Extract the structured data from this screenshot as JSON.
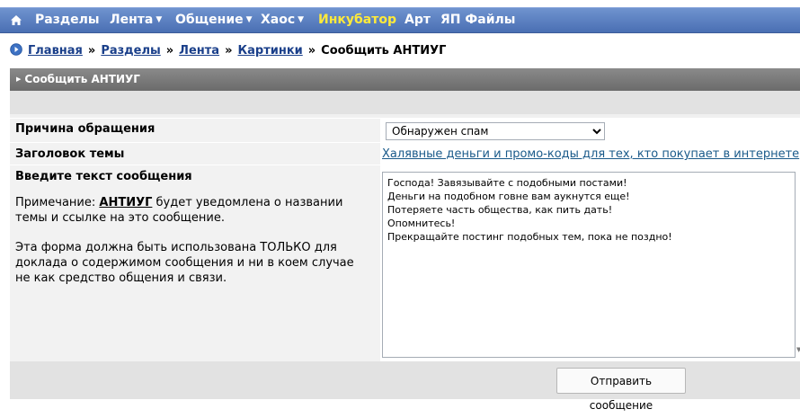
{
  "nav": {
    "items": [
      {
        "label": "Разделы",
        "dropdown": false
      },
      {
        "label": "Лента",
        "dropdown": true
      },
      {
        "label": "Общение",
        "dropdown": true
      },
      {
        "label": "Хаос",
        "dropdown": true
      },
      {
        "label": "Инкубатор",
        "dropdown": false,
        "color": "#ffea3a"
      },
      {
        "label": "Арт",
        "dropdown": false
      },
      {
        "label": "ЯП Файлы",
        "dropdown": false
      }
    ],
    "home_icon": "home-icon",
    "caret_icon": "triangle-down-icon",
    "bar_color": "#5b7fc1"
  },
  "breadcrumb": {
    "icon": "circle-arrow-icon",
    "items": [
      "Главная",
      "Разделы",
      "Лента",
      "Картинки"
    ],
    "separator": "»",
    "current": "Сообщить АНТИУГ"
  },
  "panel": {
    "title": "Сообщить АНТИУГ"
  },
  "form": {
    "reason_label": "Причина обращения",
    "reason_value": "Обнаружен спам",
    "topic_label": "Заголовок темы",
    "topic_link": "Халявные деньги и промо-коды для тех, кто покупает в интернете",
    "message_label": "Введите текст сообщения",
    "note_prefix": "Примечание: ",
    "note_bold": "АНТИУГ",
    "note_suffix": " будет уведомлена о названии темы и ссылке на это сообщение.",
    "note_2": "Эта форма должна быть использована ТОЛЬКО для доклада о содержимом сообщения и ни в коем случае не как средство общения и связи.",
    "message_text": "Господа! Завязывайте с подобными постами!\nДеньги на подобном говне вам аукнутся еще!\nПотеряете часть общества, как пить дать!\nОпомнитесь!\nПрекращайте постинг подобных тем, пока не поздно!",
    "submit_label": "Отправить сообщение"
  }
}
